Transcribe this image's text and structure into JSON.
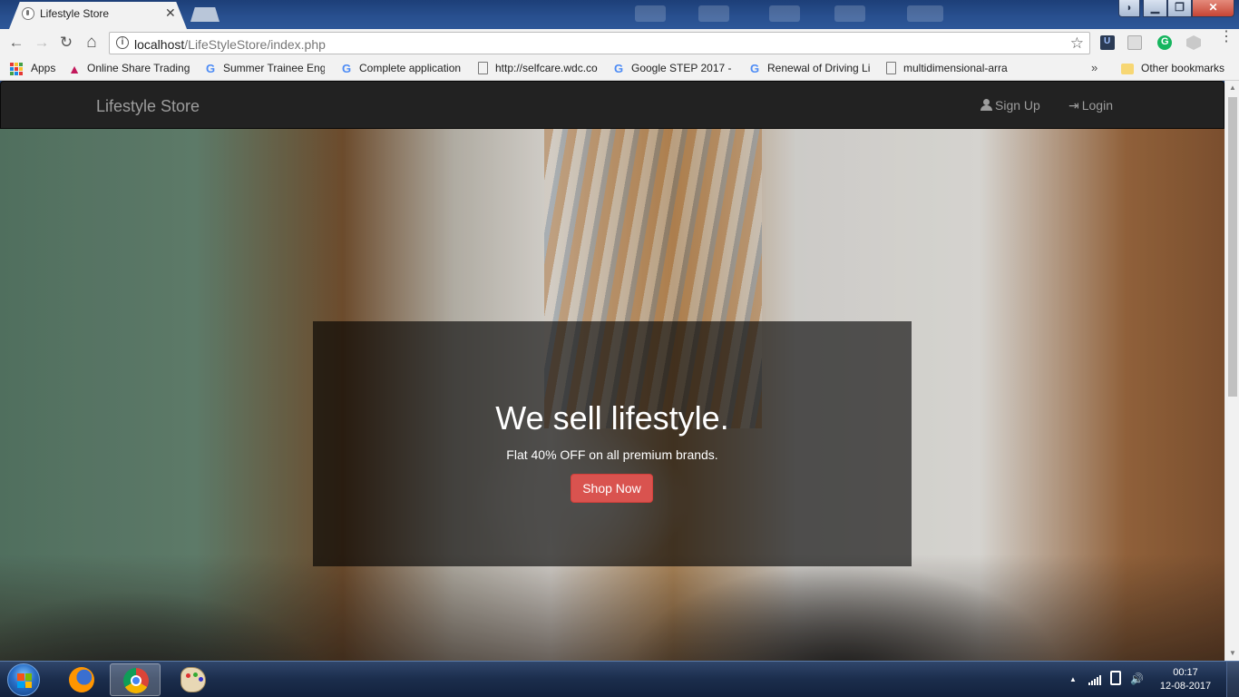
{
  "browser": {
    "tab": {
      "title": "Lifestyle Store",
      "close_glyph": "✕"
    },
    "toolbar": {
      "back_glyph": "←",
      "forward_glyph": "→",
      "reload_glyph": "↻",
      "home_glyph": "⌂",
      "url_host": "localhost",
      "url_path": "/LifeStyleStore/index.php",
      "star_glyph": "☆",
      "menu_glyph": "⋮"
    },
    "bookmarks": [
      {
        "label": "Apps",
        "icon": "apps-icon"
      },
      {
        "label": "Online Share Trading",
        "icon": "share-trading-icon"
      },
      {
        "label": "Summer Trainee Engi",
        "icon": "google-icon"
      },
      {
        "label": "Complete application",
        "icon": "google-icon"
      },
      {
        "label": "http://selfcare.wdc.co",
        "icon": "page-icon"
      },
      {
        "label": "Google STEP 2017 - S",
        "icon": "google-icon"
      },
      {
        "label": "Renewal of Driving Li",
        "icon": "google-icon"
      },
      {
        "label": "multidimensional-arra",
        "icon": "page-icon"
      }
    ],
    "bookmarks_overflow": "»",
    "other_bookmarks": "Other bookmarks"
  },
  "site": {
    "brand": "Lifestyle Store",
    "nav": {
      "signup": "Sign Up",
      "login": "Login",
      "login_glyph": "⇥"
    },
    "banner": {
      "headline": "We sell lifestyle.",
      "subline": "Flat 40% OFF on all premium brands.",
      "cta": "Shop Now"
    }
  },
  "taskbar": {
    "clock_time": "00:17",
    "clock_date": "12-08-2017",
    "tray_up_glyph": "▲",
    "volume_glyph": "🔊"
  },
  "colors": {
    "navbar_bg": "#222222",
    "nav_text": "#9d9d9d",
    "cta_bg": "#d9534f"
  }
}
